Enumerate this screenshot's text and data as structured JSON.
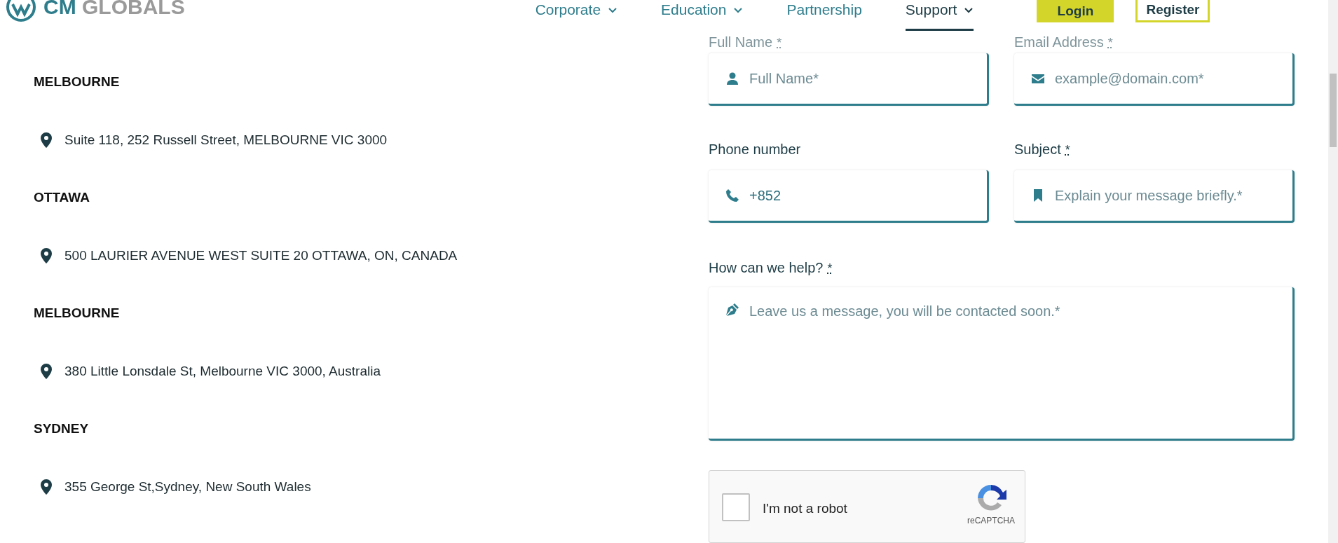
{
  "header": {
    "logo": {
      "brand": "CM",
      "name": "GLOBALS"
    },
    "nav": [
      {
        "label": "Corporate",
        "dropdown": true,
        "selected": false
      },
      {
        "label": "Education",
        "dropdown": true,
        "selected": false
      },
      {
        "label": "Partnership",
        "dropdown": false,
        "selected": false
      },
      {
        "label": "Support",
        "dropdown": true,
        "selected": true
      }
    ],
    "login": "Login",
    "register": "Register"
  },
  "offices": [
    {
      "city": "MELBOURNE",
      "address": "Suite 118, 252 Russell Street, MELBOURNE VIC 3000"
    },
    {
      "city": "OTTAWA",
      "address": "500 LAURIER AVENUE WEST SUITE 20 OTTAWA, ON, CANADA"
    },
    {
      "city": "MELBOURNE",
      "address": "380 Little Lonsdale St, Melbourne VIC 3000, Australia"
    },
    {
      "city": "SYDNEY",
      "address": "355 George St,Sydney, New South Wales"
    }
  ],
  "form": {
    "rows": [
      [
        {
          "label": "Full Name",
          "required_mark": "*",
          "placeholder": "Full Name*"
        },
        {
          "label": "Email Address",
          "required_mark": "*",
          "placeholder": "example@domain.com*"
        }
      ],
      [
        {
          "label": "Phone number",
          "value": "+852"
        },
        {
          "label": "Subject",
          "required_mark": "*",
          "placeholder": "Explain your message briefly.*"
        }
      ]
    ],
    "message": {
      "label": "How can we help?",
      "required_mark": "*",
      "placeholder": "Leave us a message, you will be contacted soon.*"
    },
    "captcha": {
      "checked": false,
      "label": "I'm not a robot",
      "brand": "reCAPTCHA"
    }
  }
}
